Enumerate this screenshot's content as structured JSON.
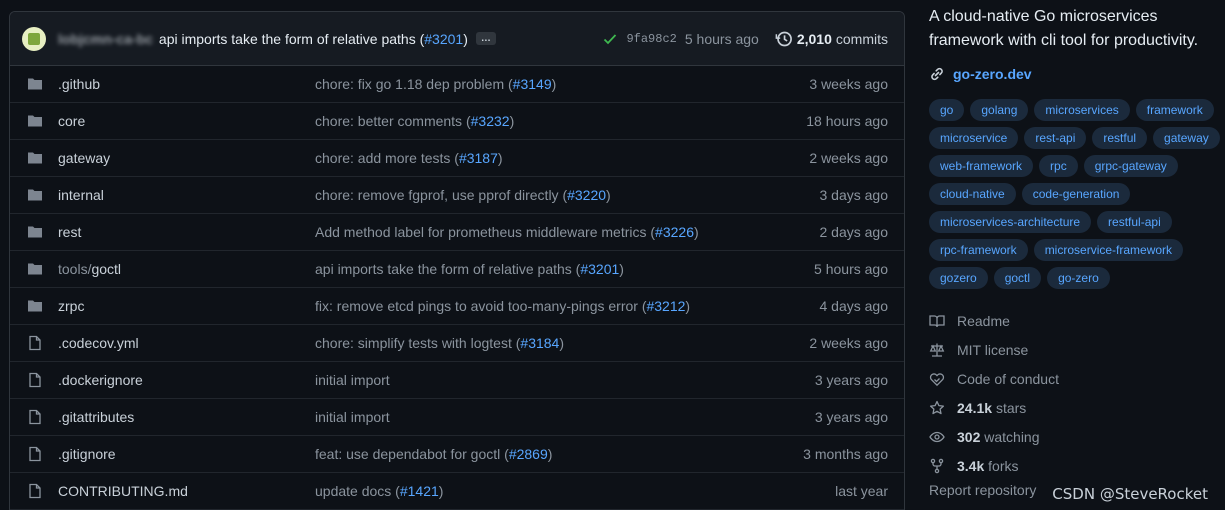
{
  "commit": {
    "author": "lobjcmn-ca-bc",
    "message": "api imports take the form of relative paths (",
    "pr": "#3201",
    "message_end": ")",
    "more_label": "…",
    "sha": "9fa98c2",
    "time": "5 hours ago",
    "count": "2,010",
    "count_label": "commits"
  },
  "files": [
    {
      "type": "dir",
      "name": ".github",
      "msg": "chore: fix go 1.18 dep problem (",
      "pr": "#3149",
      "end": ")",
      "age": "3 weeks ago"
    },
    {
      "type": "dir",
      "name": "core",
      "msg": "chore: better comments (",
      "pr": "#3232",
      "end": ")",
      "age": "18 hours ago"
    },
    {
      "type": "dir",
      "name": "gateway",
      "msg": "chore: add more tests (",
      "pr": "#3187",
      "end": ")",
      "age": "2 weeks ago"
    },
    {
      "type": "dir",
      "name": "internal",
      "msg": "chore: remove fgprof, use pprof directly (",
      "pr": "#3220",
      "end": ")",
      "age": "3 days ago"
    },
    {
      "type": "dir",
      "name": "rest",
      "msg": "Add method label for prometheus middleware metrics (",
      "pr": "#3226",
      "end": ")",
      "age": "2 days ago"
    },
    {
      "type": "dir",
      "name": "tools/goctl",
      "msg": "api imports take the form of relative paths (",
      "pr": "#3201",
      "end": ")",
      "age": "5 hours ago"
    },
    {
      "type": "dir",
      "name": "zrpc",
      "msg": "fix: remove etcd pings to avoid too-many-pings error (",
      "pr": "#3212",
      "end": ")",
      "age": "4 days ago"
    },
    {
      "type": "file",
      "name": ".codecov.yml",
      "msg": "chore: simplify tests with logtest (",
      "pr": "#3184",
      "end": ")",
      "age": "2 weeks ago"
    },
    {
      "type": "file",
      "name": ".dockerignore",
      "msg": "initial import",
      "pr": "",
      "end": "",
      "age": "3 years ago"
    },
    {
      "type": "file",
      "name": ".gitattributes",
      "msg": "initial import",
      "pr": "",
      "end": "",
      "age": "3 years ago"
    },
    {
      "type": "file",
      "name": ".gitignore",
      "msg": "feat: use dependabot for goctl (",
      "pr": "#2869",
      "end": ")",
      "age": "3 months ago"
    },
    {
      "type": "file",
      "name": "CONTRIBUTING.md",
      "msg": "update docs (",
      "pr": "#1421",
      "end": ")",
      "age": "last year"
    }
  ],
  "about": {
    "description": "A cloud-native Go microservices framework with cli tool for productivity.",
    "website": "go-zero.dev",
    "topics": [
      "go",
      "golang",
      "microservices",
      "framework",
      "microservice",
      "rest-api",
      "restful",
      "gateway",
      "web-framework",
      "rpc",
      "grpc-gateway",
      "cloud-native",
      "code-generation",
      "microservices-architecture",
      "restful-api",
      "rpc-framework",
      "microservice-framework",
      "gozero",
      "goctl",
      "go-zero"
    ],
    "readme": "Readme",
    "license": "MIT license",
    "conduct": "Code of conduct",
    "stars_value": "24.1k",
    "stars_label": "stars",
    "watching_value": "302",
    "watching_label": "watching",
    "forks_value": "3.4k",
    "forks_label": "forks",
    "report": "Report repository"
  },
  "watermark": "CSDN @SteveRocket",
  "colors": {
    "background": "#0d1117",
    "link": "#58a6ff",
    "topic_bg": "#1b2a3c",
    "success": "#3fb950"
  }
}
